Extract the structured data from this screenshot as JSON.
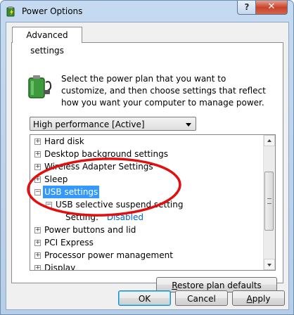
{
  "window": {
    "title": "Power Options",
    "help_label": "?",
    "close_label": "✕"
  },
  "tabs": [
    {
      "label": "Advanced settings"
    }
  ],
  "intro": "Select the power plan that you want to customize, and then choose settings that reflect how you want your computer to manage power.",
  "plan_select": {
    "value": "High performance [Active]"
  },
  "tree": {
    "items": [
      {
        "label": "Hard disk",
        "expander": "+"
      },
      {
        "label": "Desktop background settings",
        "expander": "+"
      },
      {
        "label": "Wireless Adapter Settings",
        "expander": "+"
      },
      {
        "label": "Sleep",
        "expander": "+"
      },
      {
        "label": "USB settings",
        "expander": "−",
        "selected": true
      },
      {
        "label": "USB selective suspend setting",
        "expander": "−"
      },
      {
        "label": "Setting:",
        "value": "Disabled"
      },
      {
        "label": "Power buttons and lid",
        "expander": "+"
      },
      {
        "label": "PCI Express",
        "expander": "+"
      },
      {
        "label": "Processor power management",
        "expander": "+"
      },
      {
        "label": "Display",
        "expander": "+"
      }
    ]
  },
  "buttons": {
    "restore": {
      "accel": "R",
      "rest": "estore plan defaults"
    },
    "ok": "OK",
    "cancel": "Cancel",
    "apply": {
      "accel": "A",
      "rest": "pply"
    }
  },
  "colors": {
    "selection": "#3399ff",
    "link": "#0066cc",
    "annotation": "#e01010"
  },
  "icons": {
    "app": "power-options-icon",
    "plan": "battery-power-icon"
  }
}
